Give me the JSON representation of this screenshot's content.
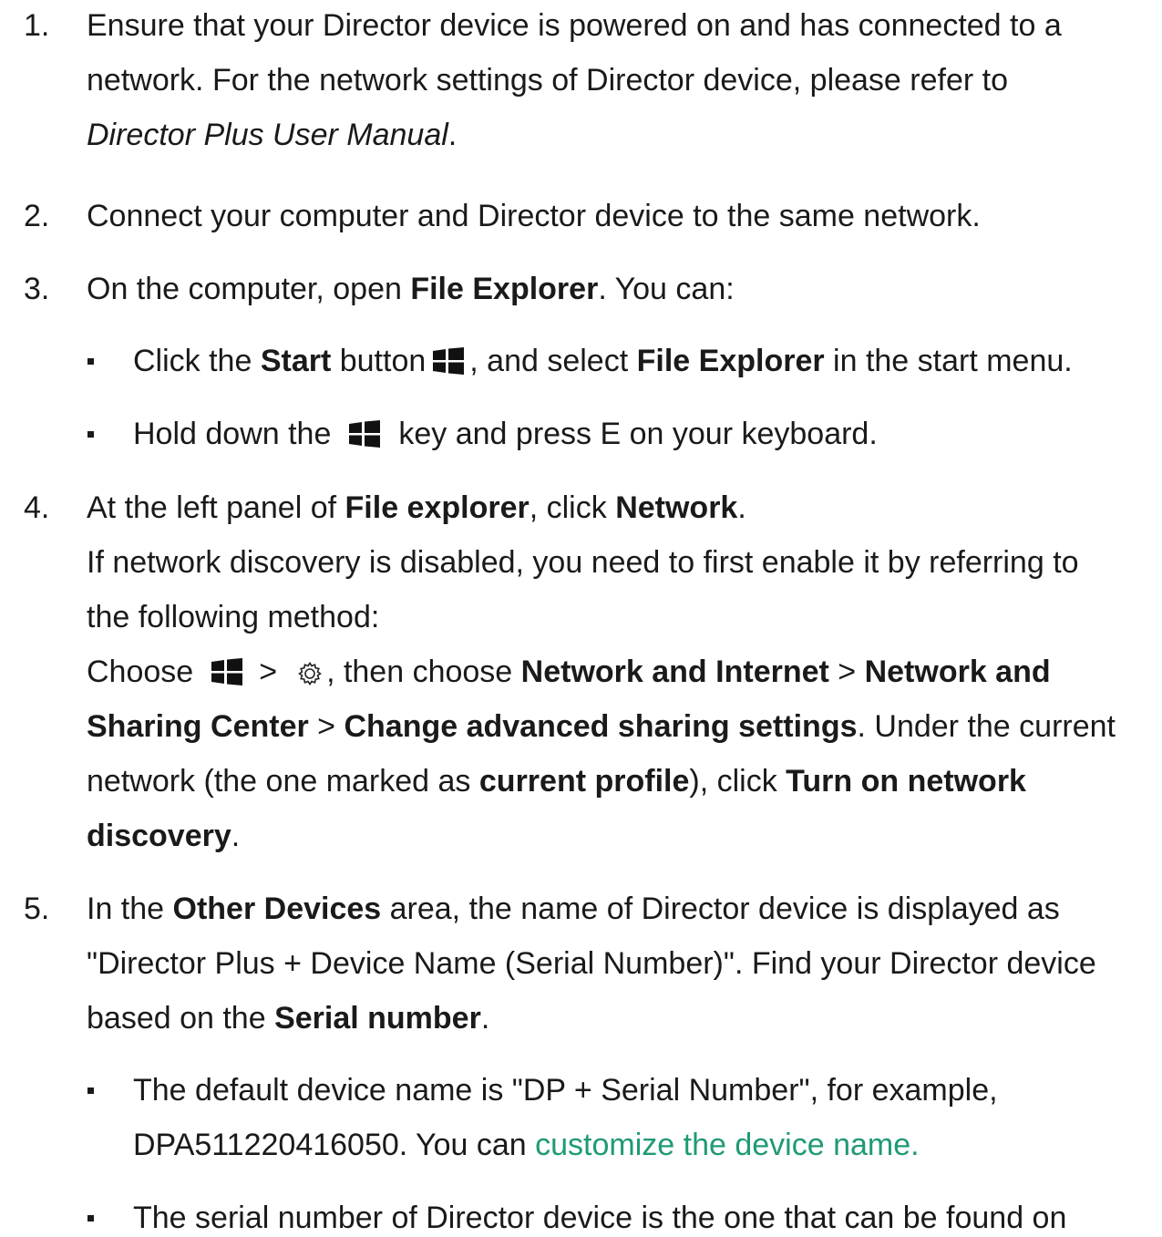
{
  "steps": [
    {
      "number": "1.",
      "line1": "Ensure that your Director device is powered on and has connected to a",
      "line2": "network. For the network settings of Director device, please refer to",
      "manual_title": "Director Plus User Manual",
      "manual_suffix": "."
    },
    {
      "number": "2.",
      "line1": "Connect your computer and Director device to the same network."
    },
    {
      "number": "3.",
      "pre": "On the computer, open ",
      "bold": "File Explorer",
      "post": ". You can:",
      "bullets": [
        {
          "pre": "Click the ",
          "bold1": "Start",
          "mid1": " button",
          "mid2": ", and select ",
          "bold2": "File Explorer",
          "post": " in the start menu."
        },
        {
          "pre": "Hold down the",
          "post": "key and press E on your keyboard."
        }
      ]
    },
    {
      "number": "4.",
      "l1_pre": "At the left panel of ",
      "l1_bold1": "File explorer",
      "l1_mid": ", click ",
      "l1_bold2": "Network",
      "l1_post": ".",
      "l2": "If network discovery is disabled, you need to first enable it by referring to",
      "l3": "the following method:",
      "l4_pre": "Choose",
      "l4_gt1": ">",
      "l4_mid": ", then choose ",
      "l4_bold1": "Network and Internet",
      "l4_gt2": " > ",
      "l4_bold2": "Network and",
      "l5_bold1": "Sharing Center",
      "l5_gt": " > ",
      "l5_bold2": "Change advanced sharing settings",
      "l5_post": ". Under the current",
      "l6_pre": "network (the one marked as ",
      "l6_bold1": "current profile",
      "l6_mid": "), click ",
      "l6_bold2": "Turn on network",
      "l7_bold": "discovery",
      "l7_post": "."
    },
    {
      "number": "5.",
      "l1_pre": "In the ",
      "l1_bold": "Other Devices",
      "l1_post": " area, the name of Director device is displayed as",
      "l2": "\"Director Plus + Device Name (Serial Number)\". Find your Director device",
      "l3_pre": "based on the ",
      "l3_bold": "Serial number",
      "l3_post": ".",
      "bullets": [
        {
          "l1": "The default device name is \"DP + Serial Number\", for example,",
          "l2_pre": "DPA511220416050. You can ",
          "l2_link": "customize the device name."
        },
        {
          "l1": "The serial number of Director device is the one that can be found on"
        }
      ]
    }
  ],
  "icons": {
    "windows": "windows-logo-icon",
    "settings": "gear-icon"
  },
  "colors": {
    "text": "#1a1a1a",
    "link": "#1f9a76"
  }
}
